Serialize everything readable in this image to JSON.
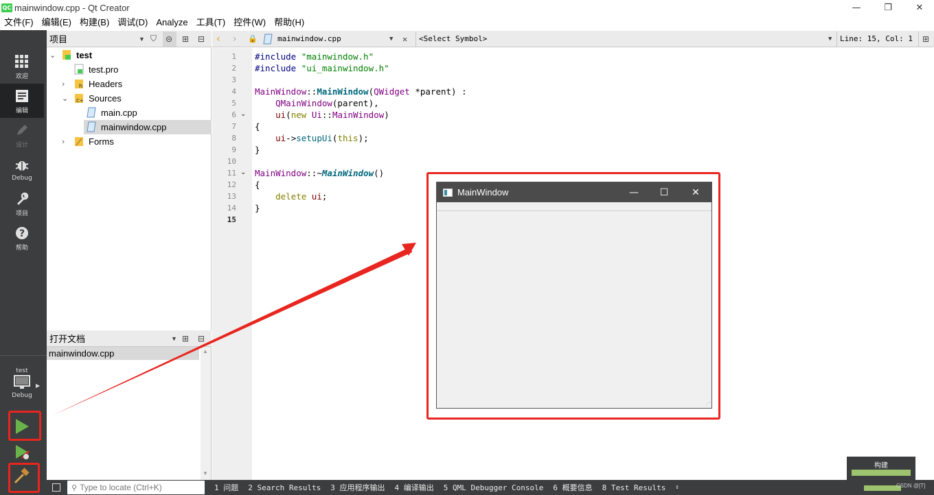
{
  "window": {
    "title": "mainwindow.cpp - Qt Creator",
    "logo_text": "QC",
    "minimize": "—",
    "maximize": "❐",
    "close": "✕"
  },
  "menu": [
    "文件(F)",
    "编辑(E)",
    "构建(B)",
    "调试(D)",
    "Analyze",
    "工具(T)",
    "控件(W)",
    "帮助(H)"
  ],
  "modes": {
    "welcome": "欢迎",
    "edit": "编辑",
    "design": "设计",
    "debug": "Debug",
    "projects": "项目",
    "help": "帮助"
  },
  "kit": {
    "project": "test",
    "config": "Debug"
  },
  "project_pane": {
    "title": "项目",
    "tree": [
      {
        "label": "test",
        "bold": true
      },
      {
        "label": "test.pro"
      },
      {
        "label": "Headers"
      },
      {
        "label": "Sources"
      },
      {
        "label": "main.cpp"
      },
      {
        "label": "mainwindow.cpp",
        "selected": true
      },
      {
        "label": "Forms"
      }
    ]
  },
  "open_docs": {
    "title": "打开文档",
    "items": [
      "mainwindow.cpp"
    ]
  },
  "editor": {
    "file": "mainwindow.cpp",
    "symbol": "<Select Symbol>",
    "position": "Line: 15, Col: 1",
    "line_numbers": [
      "1",
      "2",
      "3",
      "4",
      "5",
      "6",
      "7",
      "8",
      "9",
      "10",
      "11",
      "12",
      "13",
      "14",
      "15"
    ],
    "colors": {
      "keyword": "#808000",
      "string": "#008000",
      "type": "#800080",
      "function": "#00677c"
    }
  },
  "statusbar": {
    "locate_placeholder": "Type to locate (Ctrl+K)",
    "tabs": [
      "1 问题",
      "2 Search Results",
      "3 应用程序输出",
      "4 编译输出",
      "5 QML Debugger Console",
      "6 概要信息",
      "8 Test Results"
    ]
  },
  "build_progress": {
    "label": "构建",
    "fraction": 1.0,
    "color": "#9dc36f"
  },
  "preview_window": {
    "title": "MainWindow",
    "minimize": "—",
    "maximize": "☐",
    "close": "✕"
  },
  "annotation": {
    "color": "#e8251f"
  },
  "watermark": "CSDN @[T]"
}
